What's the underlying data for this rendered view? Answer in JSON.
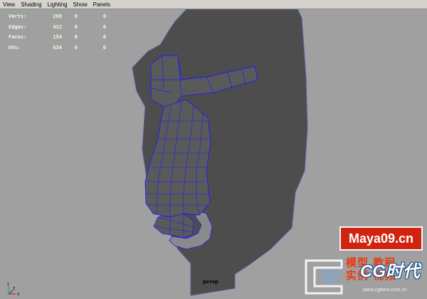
{
  "menu": {
    "items": [
      "View",
      "Shading",
      "Lighting",
      "Show",
      "Panels"
    ]
  },
  "hud": {
    "rows": [
      {
        "label": "Verts:",
        "values": [
          "268",
          "0",
          "0"
        ]
      },
      {
        "label": "Edges:",
        "values": [
          "422",
          "0",
          "0"
        ]
      },
      {
        "label": "Faces:",
        "values": [
          "154",
          "0",
          "0"
        ]
      },
      {
        "label": "UVs:",
        "values": [
          "634",
          "0",
          "0"
        ]
      }
    ]
  },
  "viewport": {
    "camera_label": "persp",
    "axis_labels": {
      "y": "Y",
      "x": "X",
      "z": "Z"
    }
  },
  "watermark": {
    "site": "Maya09.cn",
    "chinese_line1": "模型 教程",
    "chinese_line2": "实例 视频",
    "brand": "CG时代",
    "url": "www.cgtime.com.cn"
  },
  "colors": {
    "viewport_bg": "#a0a0a0",
    "silhouette": "#4d4d4d",
    "mesh_face": "#5a5a5a",
    "mesh_wire": "#1c1cff",
    "hud_text": "#e8ffe0",
    "watermark_red": "#d02410"
  }
}
